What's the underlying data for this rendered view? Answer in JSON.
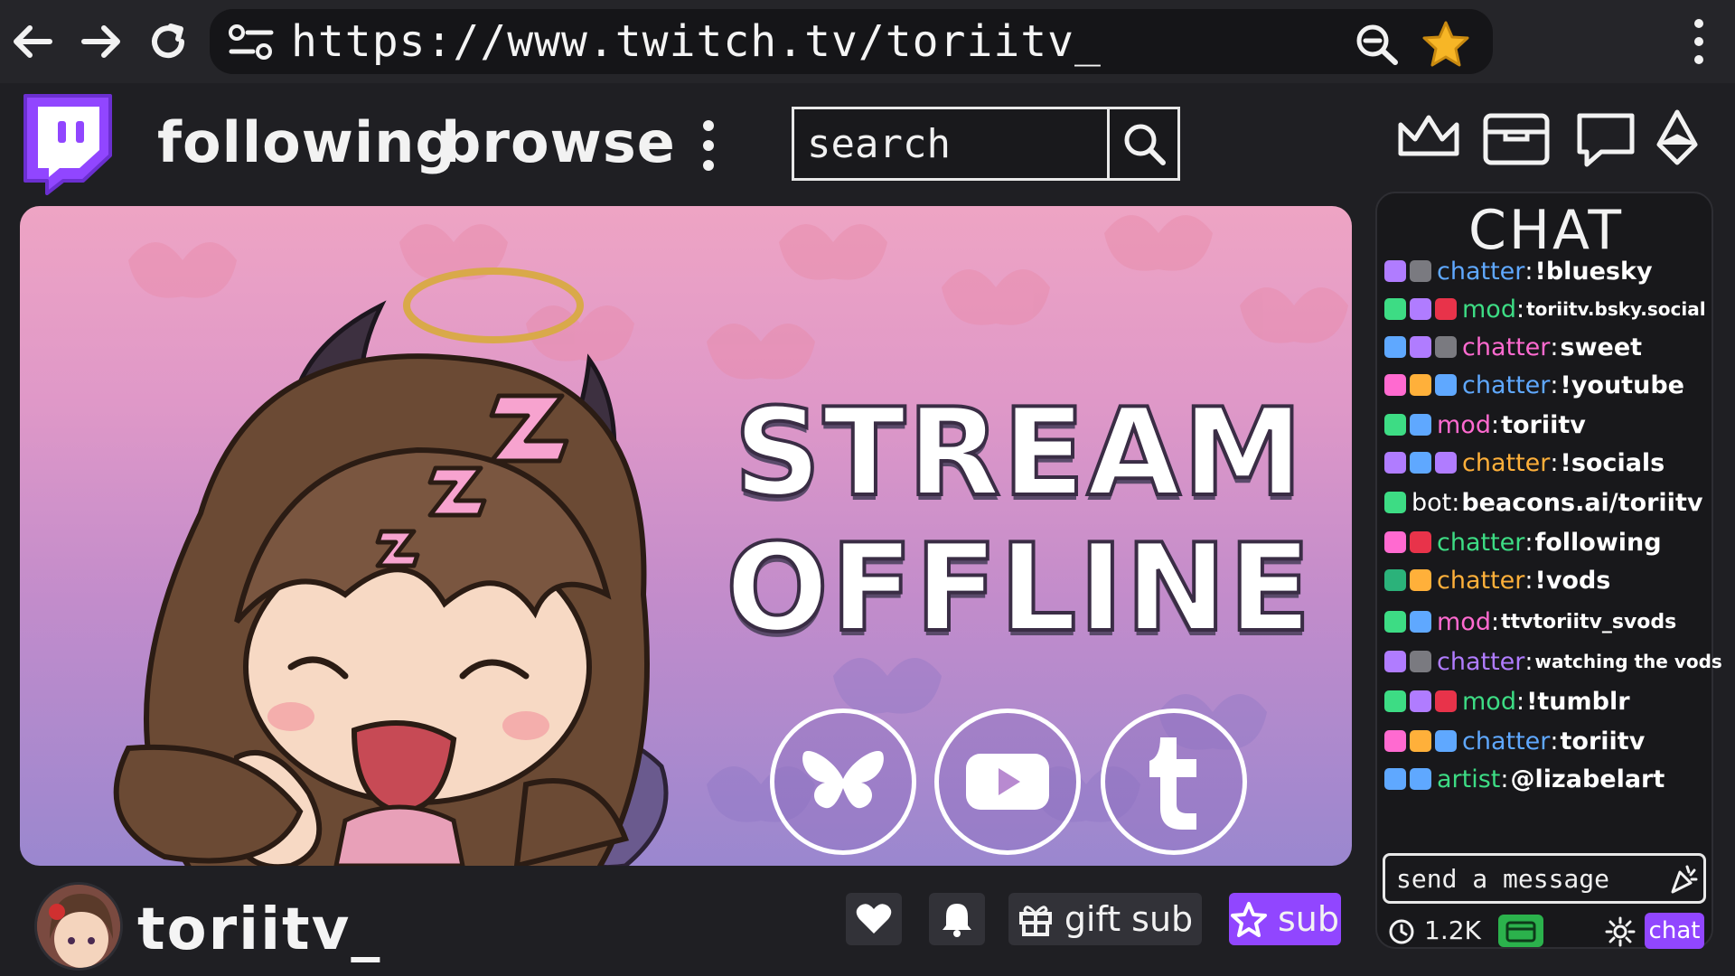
{
  "browser": {
    "url": "https://www.twitch.tv/toriitv_"
  },
  "nav": {
    "following": "following",
    "browse": "browse",
    "search_placeholder": "search"
  },
  "player": {
    "line1": "STREAM",
    "line2": "OFFLINE",
    "socials": [
      "bluesky-icon",
      "youtube-icon",
      "tumblr-icon"
    ]
  },
  "channel": {
    "name": "toriitv_"
  },
  "actions": {
    "gift_sub": "gift sub",
    "sub": "sub"
  },
  "chat": {
    "title": "CHAT",
    "messages": [
      {
        "user": "chatter",
        "sep": ":",
        "msg": "!bluesky"
      },
      {
        "user": "mod",
        "sep": ":",
        "msg": "toriitv.bsky.social"
      },
      {
        "user": "chatter",
        "sep": ":",
        "msg": "sweet"
      },
      {
        "user": "chatter",
        "sep": ":",
        "msg": " !youtube"
      },
      {
        "user": "mod",
        "sep": ":",
        "msg": " toriitv"
      },
      {
        "user": "chatter",
        "sep": ":",
        "msg": " !socials"
      },
      {
        "user": "bot",
        "sep": ":",
        "msg": " beacons.ai/toriitv"
      },
      {
        "user": "chatter",
        "sep": ":",
        "msg": " following"
      },
      {
        "user": "chatter",
        "sep": ":",
        "msg": " !vods"
      },
      {
        "user": "mod",
        "sep": ":",
        "msg": " ttvtoriitv_svods"
      },
      {
        "user": "chatter",
        "sep": ":",
        "msg": " watching the vods"
      },
      {
        "user": "mod",
        "sep": ":",
        "msg": "!tumblr"
      },
      {
        "user": "chatter",
        "sep": ":",
        "msg": " toriitv"
      },
      {
        "user": "artist",
        "sep": ":",
        "msg": "@lizabelart"
      }
    ],
    "input_placeholder": "send a message",
    "viewers": "1.2K",
    "send_label": "chat"
  },
  "colors": {
    "twitch_purple": "#9146ff",
    "chat_blue": "#5fa8ff",
    "chat_green": "#3ddc84",
    "chat_pink": "#ff5ac8",
    "chat_purple": "#b07cff",
    "chat_orange": "#ffb03a",
    "chat_white": "#ffffff"
  }
}
